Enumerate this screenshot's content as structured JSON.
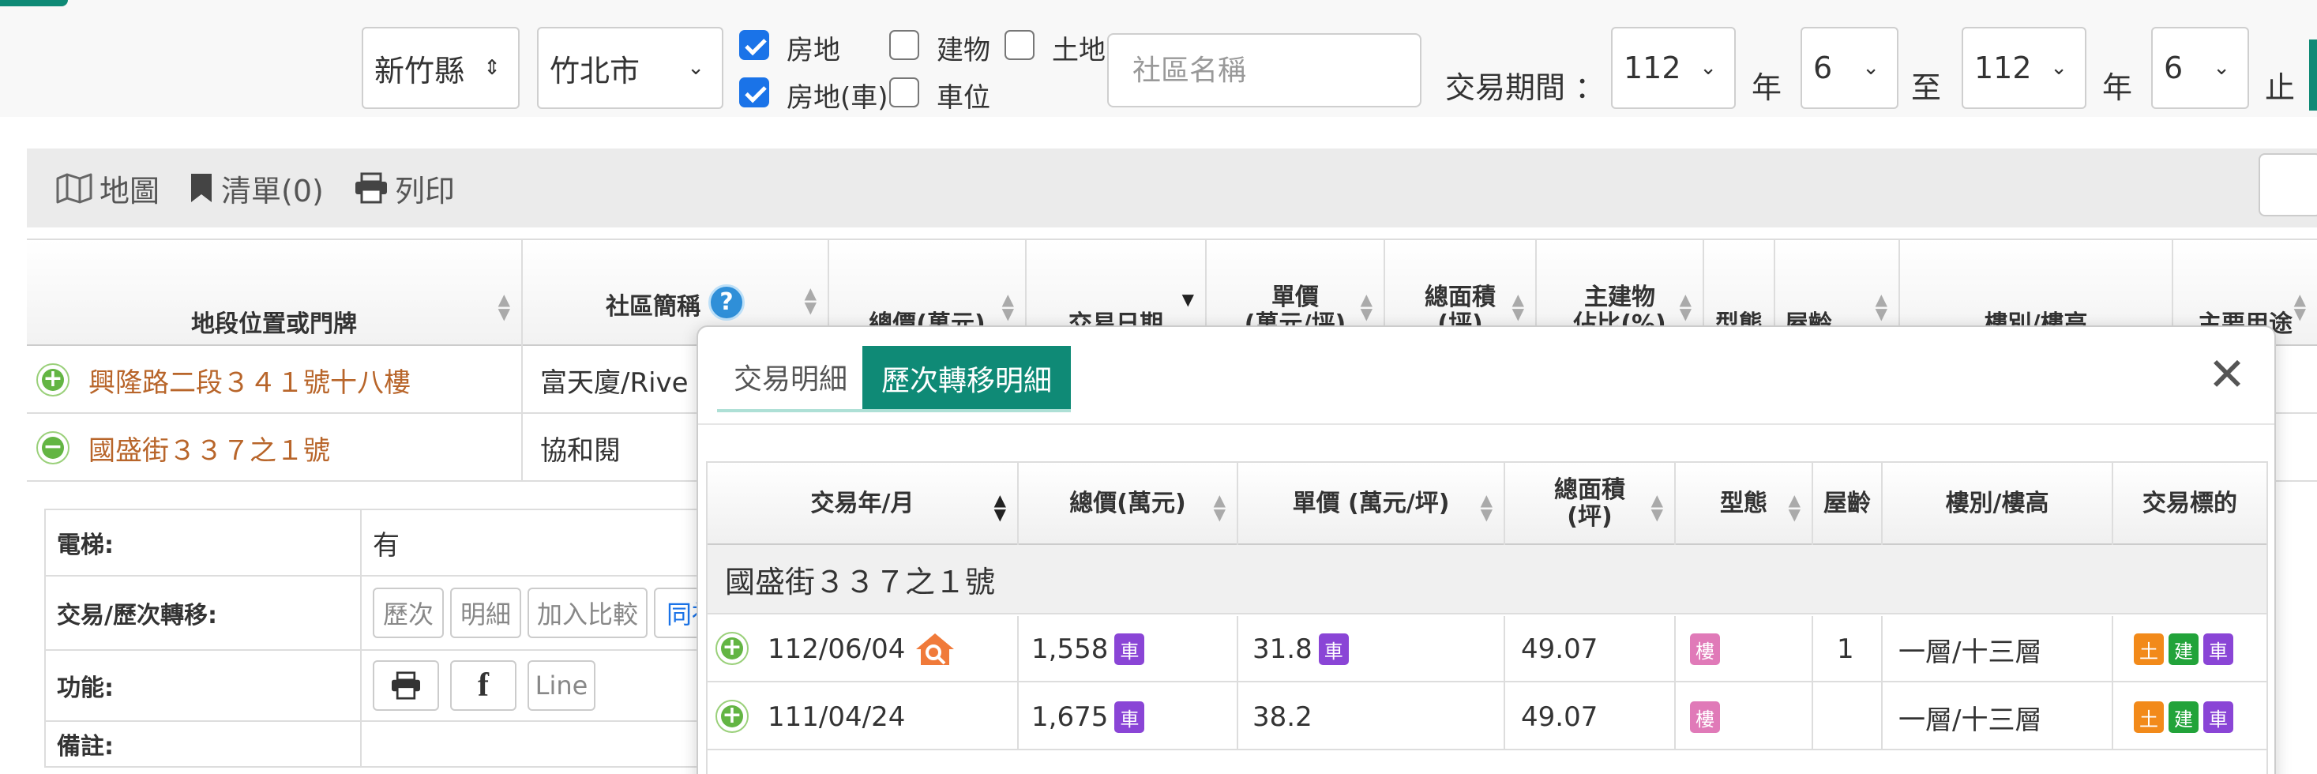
{
  "filters": {
    "county": "新竹縣",
    "city": "竹北市",
    "types": [
      {
        "label": "房地",
        "checked": true
      },
      {
        "label": "建物",
        "checked": false
      },
      {
        "label": "土地",
        "checked": false
      },
      {
        "label": "房地(車)",
        "checked": true
      },
      {
        "label": "車位",
        "checked": false
      }
    ],
    "community_placeholder": "社區名稱",
    "period_label": "交易期間 ：",
    "from_year": "112",
    "from_month": "6",
    "to_year": "112",
    "to_month": "6",
    "year_label": "年",
    "to_label": "至",
    "end_label": "止"
  },
  "toolbar": {
    "map": "地圖",
    "list": "清單(0)",
    "print": "列印"
  },
  "main_table": {
    "headers": [
      "地段位置或門牌",
      "社區簡稱",
      "總價(萬元)",
      "交易日期",
      "單價\n(萬元/坪)",
      "總面積\n(坪)",
      "主建物\n佔比(%)",
      "型態",
      "屋齡",
      "樓別/樓高",
      "主要用途"
    ],
    "rows": [
      {
        "address": "興隆路二段３４１號十八樓",
        "community": "富天廈/Rive",
        "expanded": false
      },
      {
        "address": "國盛街３３７之１號",
        "community": "協和閱",
        "expanded": true
      }
    ]
  },
  "detail": {
    "elevator_label": "電梯:",
    "elevator_value": "有",
    "transfer_label": "交易/歷次轉移:",
    "transfer_buttons": [
      "歷次",
      "明細",
      "加入比較",
      "同社"
    ],
    "function_label": "功能:",
    "line_button": "Line",
    "note_label": "備註:"
  },
  "modal": {
    "tab_detail": "交易明細",
    "tab_history": "歷次轉移明細",
    "close": "✕",
    "headers": [
      "交易年/月",
      "總價(萬元)",
      "單價 (萬元/坪)",
      "總面積\n(坪)",
      "型態",
      "屋齡",
      "樓別/樓高",
      "交易標的"
    ],
    "group": "國盛街３３７之１號",
    "rows": [
      {
        "date": "112/06/04",
        "total": "1,558",
        "total_badge": "車",
        "unit": "31.8",
        "unit_badge": "車",
        "area": "49.07",
        "type": "樓",
        "age": "1",
        "floor": "一層/十三層",
        "targets": [
          "土",
          "建",
          "車"
        ]
      },
      {
        "date": "111/04/24",
        "total": "1,675",
        "total_badge": "車",
        "unit": "38.2",
        "unit_badge": "",
        "area": "49.07",
        "type": "樓",
        "age": "",
        "floor": "一層/十三層",
        "targets": [
          "土",
          "建",
          "車"
        ]
      }
    ]
  },
  "colors": {
    "accent": "#0f8a76",
    "address": "#b8652a",
    "badge_purple": "#8a45d6",
    "badge_pink": "#e07ab8",
    "badge_orange": "#f28a1a",
    "badge_green": "#22a33a"
  }
}
